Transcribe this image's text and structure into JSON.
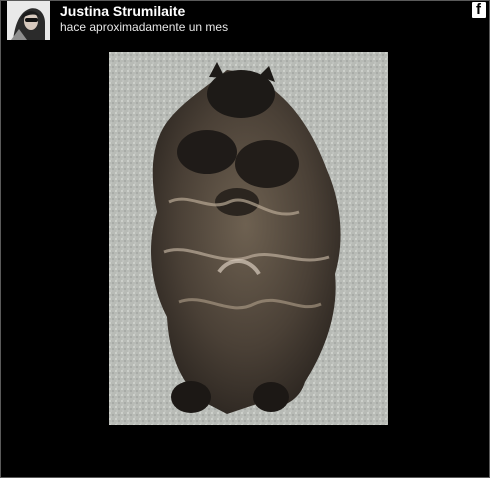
{
  "post": {
    "author": "Justina Strumilaite",
    "time": "hace aproximadamente un mes",
    "network_icon": "facebook-icon",
    "photo_subject": "long-haired cat on carpet"
  }
}
